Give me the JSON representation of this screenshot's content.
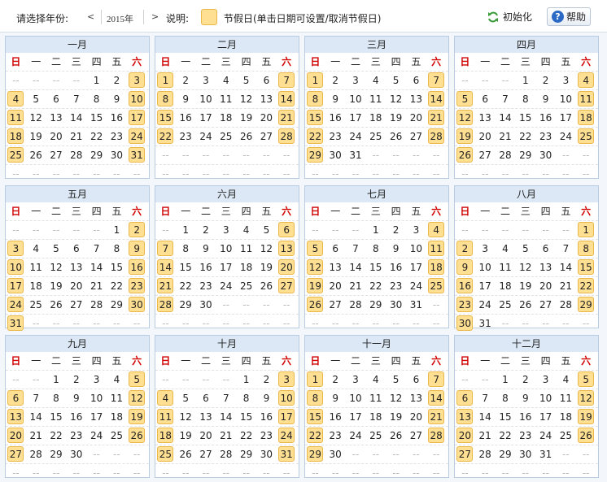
{
  "toolbar": {
    "year_label": "请选择年份:",
    "prev": "<",
    "year": "2015年",
    "next": ">",
    "desc_label": "说明:",
    "legend_text": "节假日(单击日期可设置/取消节假日)",
    "init_label": "初始化",
    "help_label": "帮助",
    "holiday_color": "#ffdf91"
  },
  "weekdays": [
    "日",
    "一",
    "二",
    "三",
    "四",
    "五",
    "六"
  ],
  "months": [
    {
      "name": "一月",
      "start": 4,
      "days": 31
    },
    {
      "name": "二月",
      "start": 0,
      "days": 28
    },
    {
      "name": "三月",
      "start": 0,
      "days": 31
    },
    {
      "name": "四月",
      "start": 3,
      "days": 30
    },
    {
      "name": "五月",
      "start": 5,
      "days": 31
    },
    {
      "name": "六月",
      "start": 1,
      "days": 30
    },
    {
      "name": "七月",
      "start": 3,
      "days": 31
    },
    {
      "name": "八月",
      "start": 6,
      "days": 31
    },
    {
      "name": "九月",
      "start": 2,
      "days": 30
    },
    {
      "name": "十月",
      "start": 4,
      "days": 31
    },
    {
      "name": "十一月",
      "start": 0,
      "days": 30
    },
    {
      "name": "十二月",
      "start": 2,
      "days": 31
    }
  ],
  "empty_mark": "--"
}
